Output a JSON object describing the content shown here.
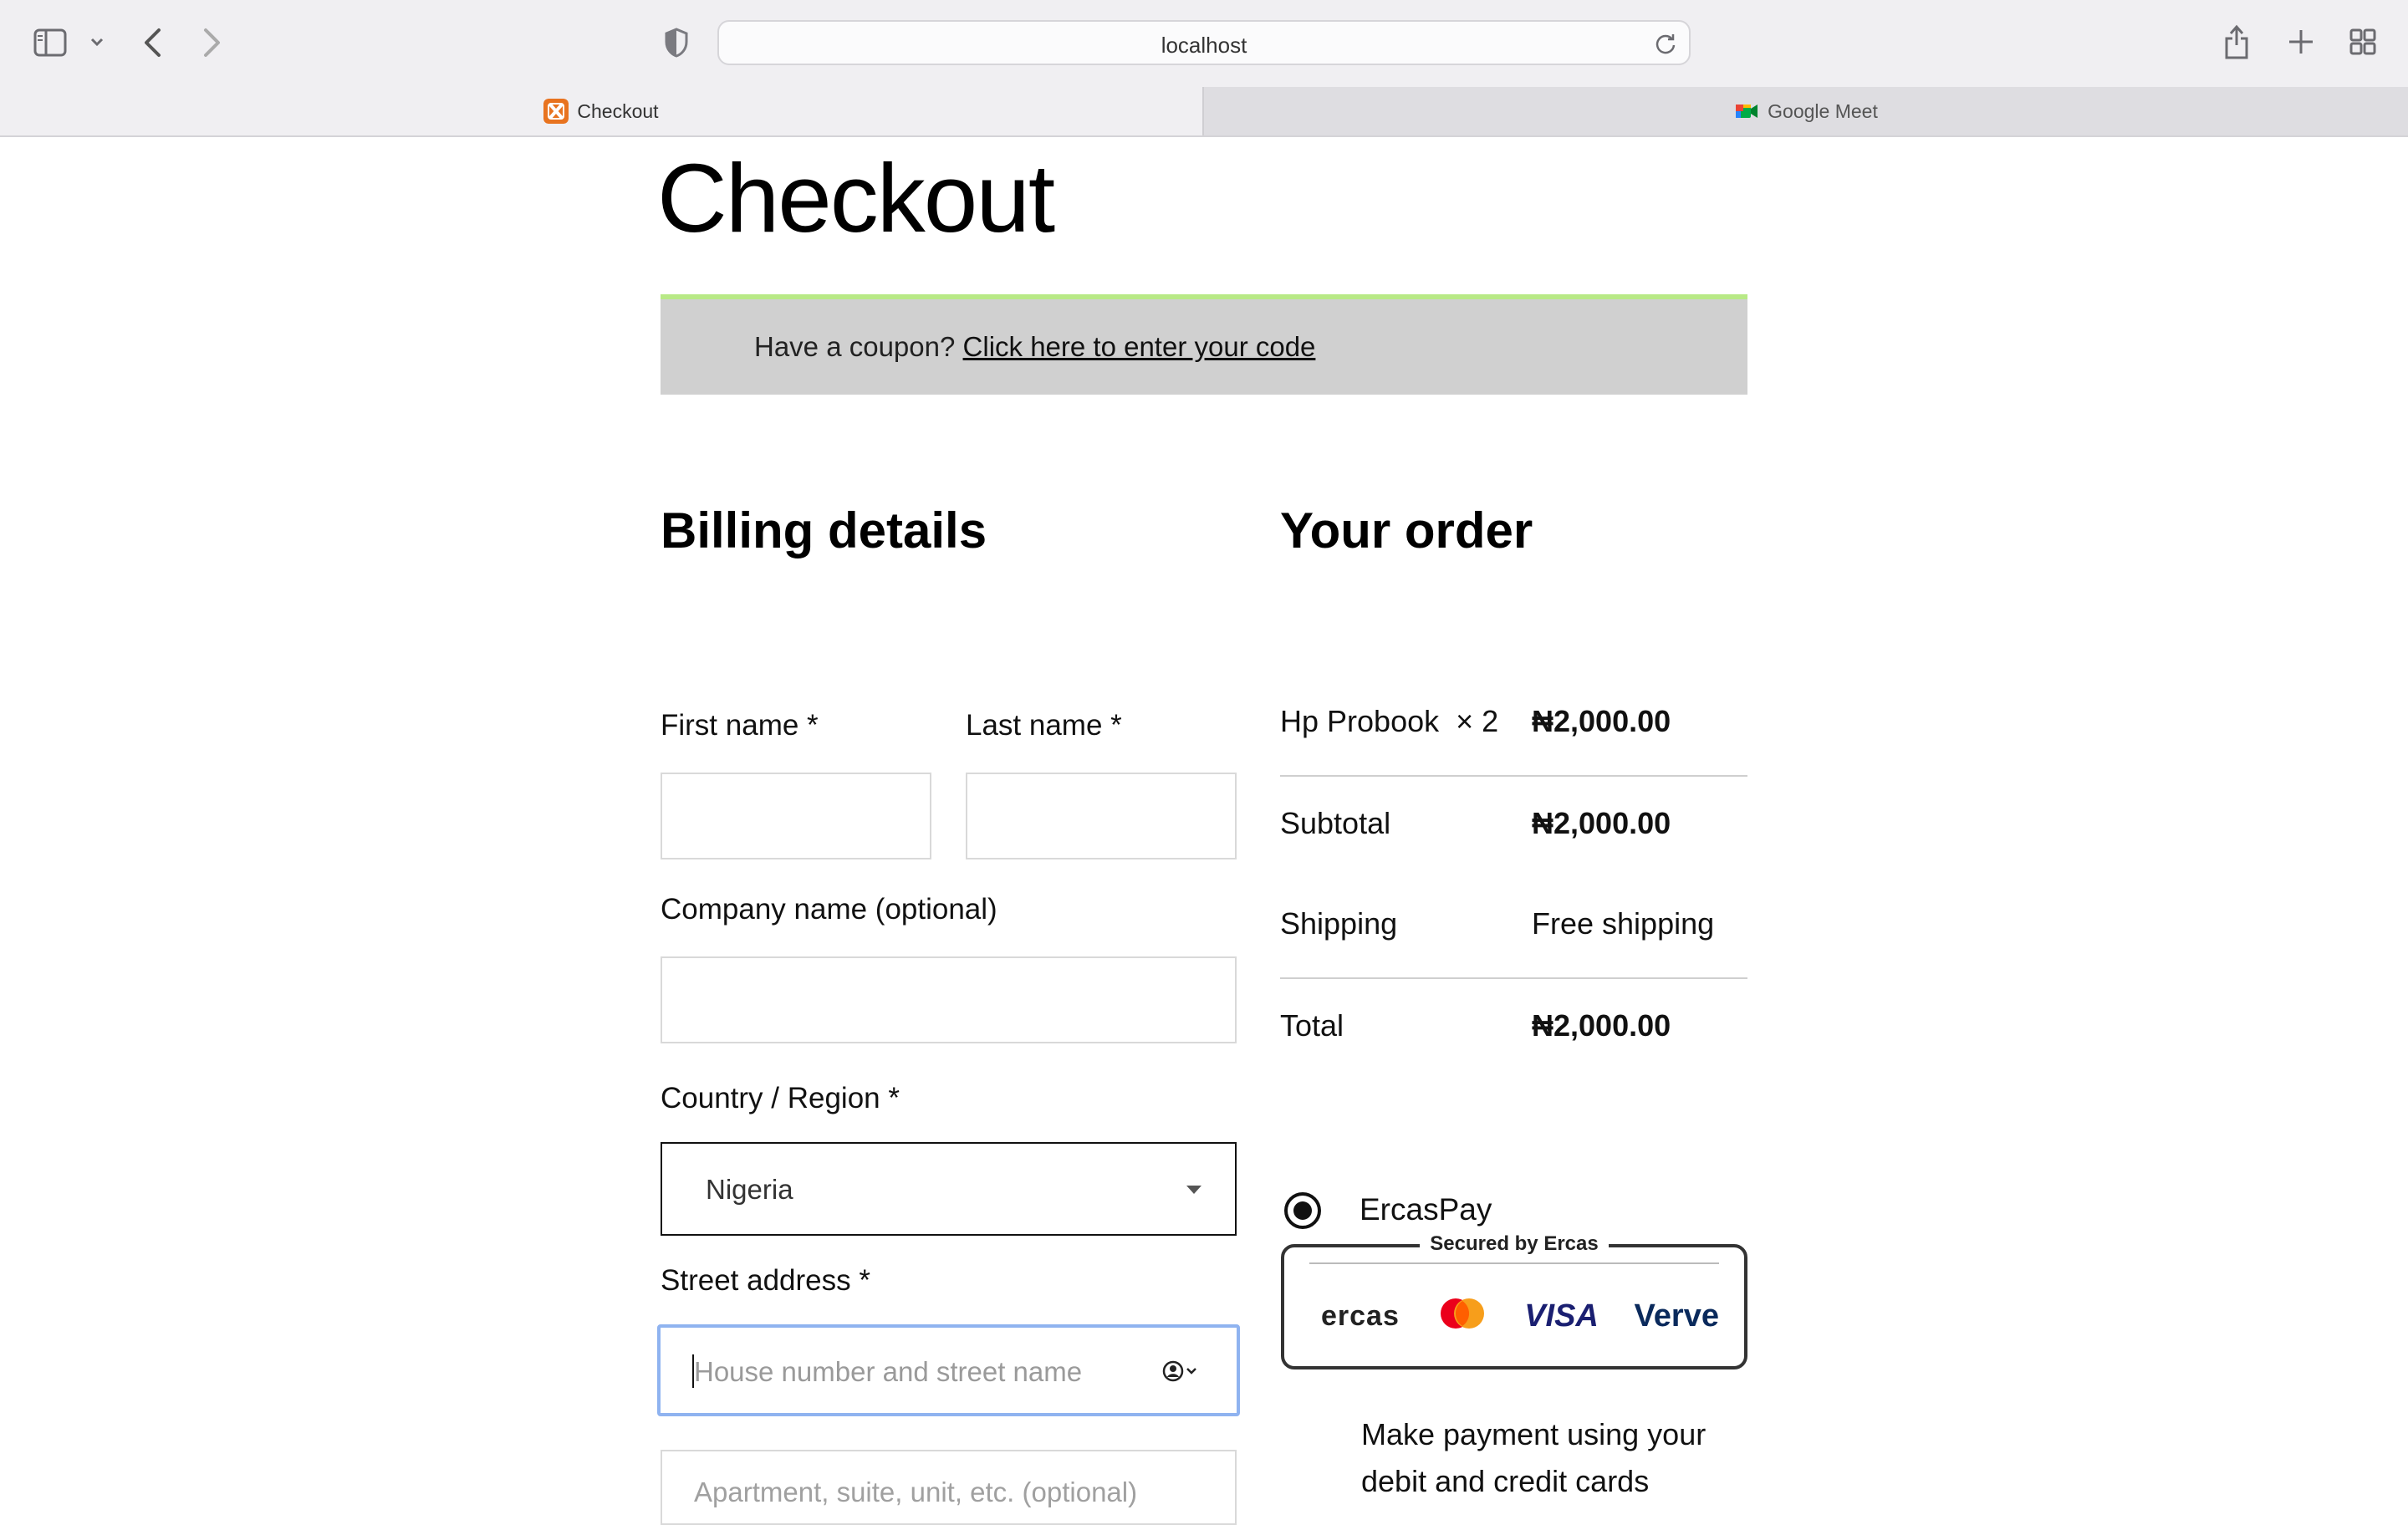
{
  "browser": {
    "address": "localhost",
    "tabs": [
      {
        "label": "Checkout",
        "active": true
      },
      {
        "label": "Google Meet",
        "active": false
      }
    ],
    "accent_color": "#8fb3f0"
  },
  "page": {
    "title": "Checkout",
    "coupon": {
      "prompt": "Have a coupon?",
      "link": "Click here to enter your code",
      "accent_color": "#b8e986"
    },
    "billing": {
      "heading": "Billing details",
      "first_name_label": "First name *",
      "first_name_value": "",
      "last_name_label": "Last name *",
      "last_name_value": "",
      "company_label": "Company name (optional)",
      "company_value": "",
      "country_label": "Country / Region *",
      "country_value": "Nigeria",
      "street_label": "Street address *",
      "street_placeholder": "House number and street name",
      "apartment_placeholder": "Apartment, suite, unit, etc. (optional)"
    },
    "order": {
      "heading": "Your order",
      "rows": [
        {
          "label": "Hp Probook  × 2",
          "value": "₦2,000.00"
        },
        {
          "label": "Subtotal",
          "value": "₦2,000.00"
        },
        {
          "label": "Shipping",
          "value": "Free shipping"
        },
        {
          "label": "Total",
          "value": "₦2,000.00"
        }
      ],
      "payment": {
        "method": "ErcasPay",
        "selected": true,
        "secured_caption": "Secured by Ercas",
        "logos": [
          "ercas",
          "mastercard",
          "VISA",
          "Verve"
        ],
        "description": "Make payment using your debit and credit cards"
      }
    }
  }
}
